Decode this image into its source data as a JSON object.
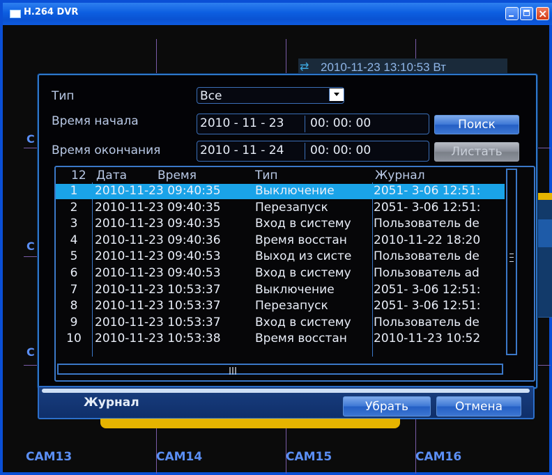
{
  "window": {
    "title": "H.264 DVR"
  },
  "clock": {
    "datetime": "2010-11-23 13:10:53 Вт"
  },
  "cameras": {
    "bottom": [
      "CAM13",
      "CAM14",
      "CAM15",
      "CAM16"
    ],
    "side_letter": "C"
  },
  "search": {
    "type_label": "Тип",
    "type_value": "Все",
    "start_label": "Время начала",
    "start_date": "2010 - 11 - 23",
    "start_time": "00: 00: 00",
    "end_label": "Время окончания",
    "end_date": "2010 - 11 - 24",
    "end_time": "00: 00: 00",
    "search_button": "Поиск",
    "page_button": "Листать"
  },
  "log_table": {
    "count": "12",
    "headers": {
      "date": "Дата",
      "time": "Время",
      "type": "Тип",
      "log": "Журнал"
    },
    "rows": [
      {
        "n": "1",
        "datetime": "2010-11-23 09:40:35",
        "type": "Выключение",
        "log": "2051- 3-06 12:51:"
      },
      {
        "n": "2",
        "datetime": "2010-11-23 09:40:35",
        "type": "Перезапуск",
        "log": "2051- 3-06 12:51:"
      },
      {
        "n": "3",
        "datetime": "2010-11-23 09:40:35",
        "type": "Вход в систему",
        "log": "Пользователь de"
      },
      {
        "n": "4",
        "datetime": "2010-11-23 09:40:36",
        "type": "Время восстан",
        "log": "2010-11-22 18:20"
      },
      {
        "n": "5",
        "datetime": "2010-11-23 09:40:53",
        "type": "Выход из систе",
        "log": "Пользователь de"
      },
      {
        "n": "6",
        "datetime": "2010-11-23 09:40:53",
        "type": "Вход в систему",
        "log": "Пользователь ad"
      },
      {
        "n": "7",
        "datetime": "2010-11-23 10:53:37",
        "type": "Выключение",
        "log": "2051- 3-06 12:51:"
      },
      {
        "n": "8",
        "datetime": "2010-11-23 10:53:37",
        "type": "Перезапуск",
        "log": "2051- 3-06 12:51:"
      },
      {
        "n": "9",
        "datetime": "2010-11-23 10:53:37",
        "type": "Вход в систему",
        "log": "Пользователь de"
      },
      {
        "n": "10",
        "datetime": "2010-11-23 10:53:38",
        "type": "Время восстан",
        "log": "2010-11-23 10:52"
      }
    ],
    "selected_row": "1"
  },
  "footer": {
    "label": "Журнал",
    "clear_button": "Убрать",
    "cancel_button": "Отмена"
  },
  "colors": {
    "accent": "#1aa3e8",
    "border": "#3b78c8",
    "cam_text": "#5b8ff5",
    "yellow": "#e6b400"
  },
  "icons": [
    "app-icon",
    "minimize-icon",
    "maximize-icon",
    "close-icon",
    "refresh-icon",
    "dropdown-arrow-icon"
  ]
}
